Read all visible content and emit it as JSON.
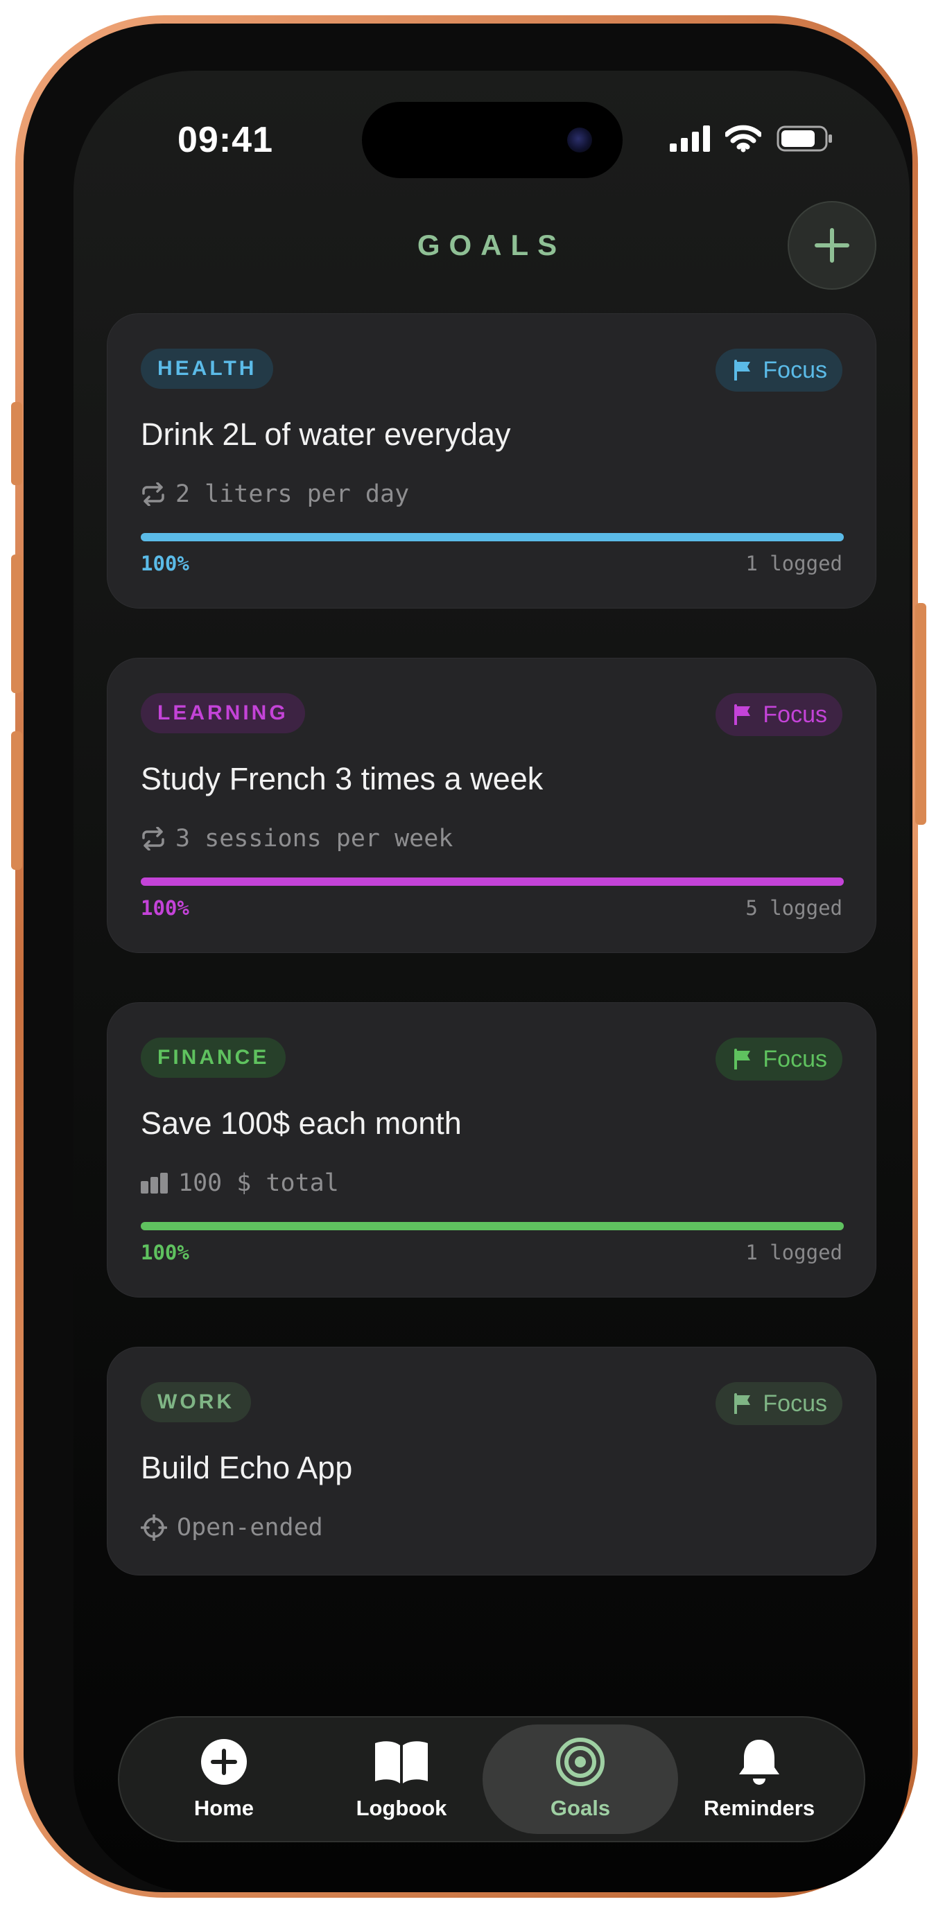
{
  "status_bar": {
    "time": "09:41"
  },
  "header": {
    "title": "GOALS"
  },
  "goals": [
    {
      "category": "HEALTH",
      "focus_label": "Focus",
      "title": "Drink 2L of water everyday",
      "meta_icon": "repeat-icon",
      "meta": "2 liters per day",
      "progress": 1.0,
      "percent_label": "100%",
      "logged": "1 logged",
      "accent": "#5bbbe8",
      "tag_bg": "#233a47",
      "focus_bg": "#233a47"
    },
    {
      "category": "LEARNING",
      "focus_label": "Focus",
      "title": "Study French 3 times a week",
      "meta_icon": "repeat-icon",
      "meta": "3 sessions per week",
      "progress": 1.0,
      "percent_label": "100%",
      "logged": "5 logged",
      "accent": "#c443d8",
      "tag_bg": "#3d2343",
      "focus_bg": "#3d2343"
    },
    {
      "category": "FINANCE",
      "focus_label": "Focus",
      "title": "Save 100$ each month",
      "meta_icon": "bar-chart-icon",
      "meta": "100 $ total",
      "progress": 1.0,
      "percent_label": "100%",
      "logged": "1 logged",
      "accent": "#5fc25f",
      "tag_bg": "#27402a",
      "focus_bg": "#27402a"
    },
    {
      "category": "WORK",
      "focus_label": "Focus",
      "title": "Build Echo App",
      "meta_icon": "crosshair-icon",
      "meta": "Open-ended",
      "accent": "#7fb585",
      "tag_bg": "#2f3a30",
      "focus_bg": "#2f3a30"
    }
  ],
  "tabbar": {
    "items": [
      {
        "label": "Home",
        "icon": "plus-circle-icon"
      },
      {
        "label": "Logbook",
        "icon": "book-icon"
      },
      {
        "label": "Goals",
        "icon": "target-icon",
        "active": true
      },
      {
        "label": "Reminders",
        "icon": "bell-icon"
      }
    ]
  }
}
